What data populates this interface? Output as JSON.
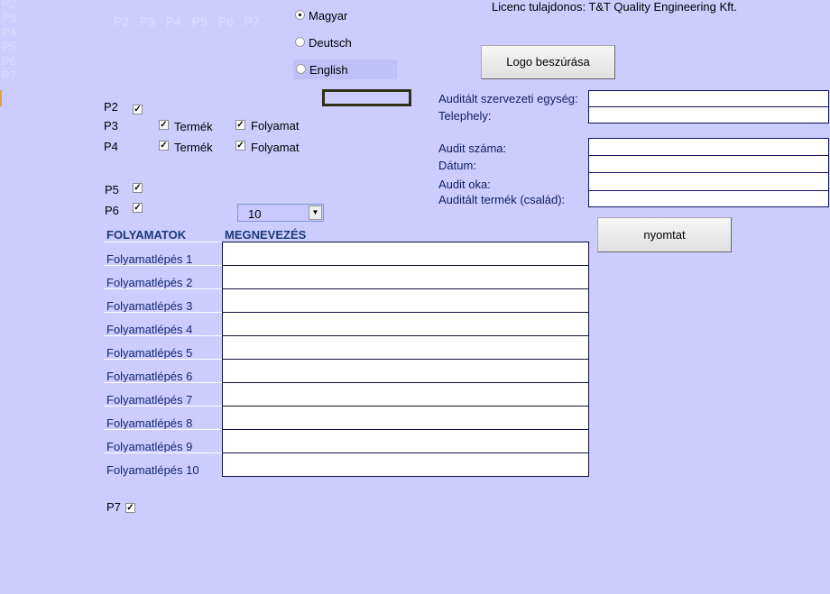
{
  "ghost_left": [
    "P2",
    "P3",
    "P4",
    "P5",
    "P6",
    "P7"
  ],
  "ghost_top": "P2  P3  P4  P5  P6  P7",
  "language": {
    "options": [
      "Magyar",
      "Deutsch",
      "English"
    ],
    "selected": "Magyar"
  },
  "license": "Licenc tulajdonos: T&T Quality Engineering Kft.",
  "logo_button": "Logo beszúrása",
  "print_button": "nyomtat",
  "sections": {
    "p2": {
      "label": "P2",
      "checked": true
    },
    "p3": {
      "label": "P3",
      "termek": "Termék",
      "folyamat": "Folyamat"
    },
    "p4": {
      "label": "P4",
      "termek": "Termék",
      "folyamat": "Folyamat"
    },
    "p5": {
      "label": "P5",
      "checked": true
    },
    "p6": {
      "label": "P6",
      "checked": true
    },
    "p7": {
      "label": "P7",
      "checked": true
    }
  },
  "step_count": "10",
  "form": {
    "org_unit": "Auditált szervezeti egység:",
    "site": "Telephely:",
    "audit_no": "Audit száma:",
    "date": "Dátum:",
    "reason": "Audit oka:",
    "product": "Auditált termék (család):"
  },
  "table": {
    "headers": [
      "FOLYAMATOK",
      "MEGNEVEZÉS"
    ],
    "rows": [
      "Folyamatlépés 1",
      "Folyamatlépés 2",
      "Folyamatlépés 3",
      "Folyamatlépés 4",
      "Folyamatlépés 5",
      "Folyamatlépés 6",
      "Folyamatlépés 7",
      "Folyamatlépés 8",
      "Folyamatlépés 9",
      "Folyamatlépés 10"
    ]
  }
}
